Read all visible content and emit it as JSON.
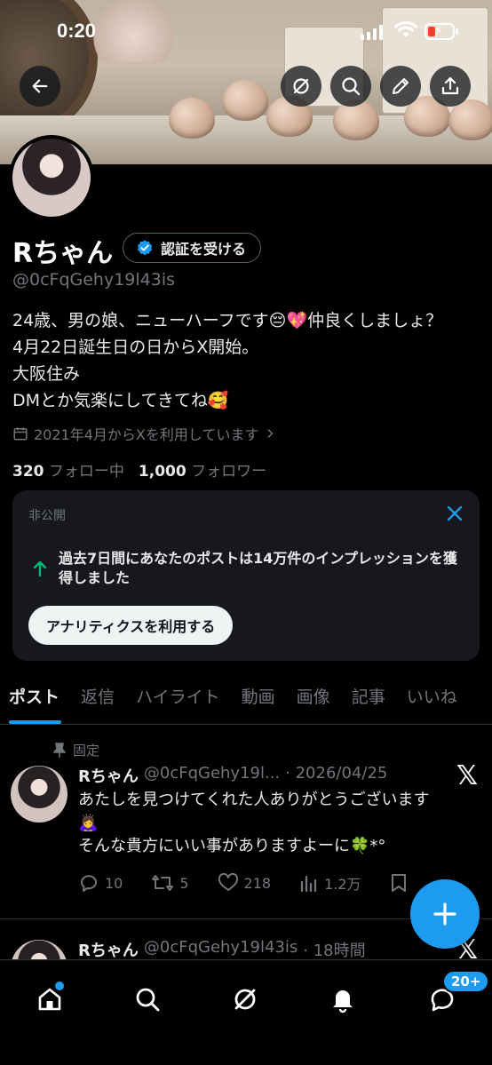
{
  "status_bar": {
    "time": "0:20"
  },
  "profile": {
    "name": "Rちゃん",
    "verify_button": "認証を受ける",
    "handle": "@0cFqGehy19l43is",
    "bio_lines": [
      "24歳、男の娘、ニューハーフです😔💖仲良くしましょ？",
      "4月22日誕生日の日からX開始。",
      "大阪住み",
      "DMとか気楽にしてきてね🥰"
    ],
    "joined": "2021年4月からXを利用しています",
    "following_count": "320",
    "following_label": "フォロー中",
    "followers_count": "1,000",
    "followers_label": "フォロワー"
  },
  "private_card": {
    "label": "非公開",
    "message": "過去7日間にあなたのポストは14万件のインプレッションを獲得しました",
    "cta": "アナリティクスを利用する"
  },
  "tabs": [
    "ポスト",
    "返信",
    "ハイライト",
    "動画",
    "画像",
    "記事",
    "いいね"
  ],
  "posts": [
    {
      "pinned_label": "固定",
      "name": "Rちゃん",
      "handle": "@0cFqGehy19l...",
      "date": "· 2026/04/25",
      "text_lines": [
        "あたしを見つけてくれた人ありがとうございます",
        "🙇‍♀️",
        "そんな貴方にいい事がありますよーに🍀*°"
      ],
      "replies": "10",
      "reposts": "5",
      "likes": "218",
      "views": "1.2万"
    },
    {
      "name": "Rちゃん",
      "handle": "@0cFqGehy19l43is",
      "date": "· 18時間"
    }
  ],
  "bottom_nav": {
    "messages_badge": "20+"
  },
  "icons": {
    "back": "back-arrow-icon",
    "grok": "grok-icon",
    "search": "search-icon",
    "edit": "pencil-icon",
    "share": "share-icon",
    "verified": "verified-badge-icon",
    "calendar": "calendar-icon",
    "close": "close-icon",
    "up_arrow": "arrow-up-icon",
    "pin": "pin-icon",
    "x_logo": "x-logo-icon",
    "reply": "reply-icon",
    "repost": "repost-icon",
    "like": "heart-icon",
    "views": "analytics-icon",
    "bookmark": "bookmark-icon",
    "compose": "plus-icon",
    "home": "home-icon",
    "bell": "bell-icon",
    "messages": "messages-icon"
  },
  "colors": {
    "accent": "#1d9bf0",
    "background": "#000000",
    "card": "#16181c",
    "secondary_text": "#71767b",
    "growth_arrow": "#00ba7c",
    "battery_low": "#ff3b30"
  }
}
